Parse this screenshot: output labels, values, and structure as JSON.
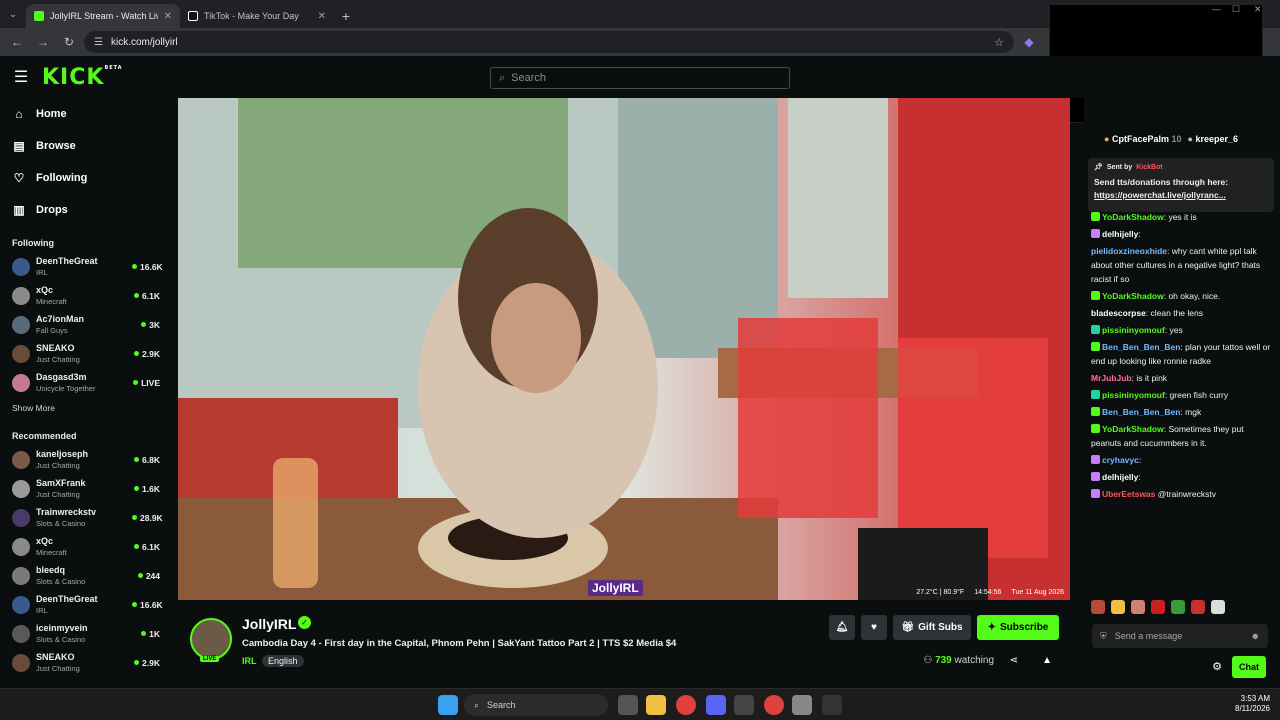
{
  "browser": {
    "tabs": [
      {
        "title": "JollyIRL Stream - Watch Live",
        "active": true,
        "favicon_color": "#53fc18"
      },
      {
        "title": "TikTok - Make Your Day",
        "active": false,
        "favicon_color": "#ffffff"
      }
    ],
    "url": "kick.com/jollyirl"
  },
  "header": {
    "logo": "KICK",
    "logo_badge": "BETA",
    "search_placeholder": "Search"
  },
  "sidebar": {
    "nav": [
      {
        "label": "Home",
        "icon": "home-icon"
      },
      {
        "label": "Browse",
        "icon": "browse-icon"
      },
      {
        "label": "Following",
        "icon": "heart-icon"
      },
      {
        "label": "Drops",
        "icon": "drops-icon"
      }
    ],
    "following_title": "Following",
    "following": [
      {
        "name": "DeenTheGreat",
        "category": "IRL",
        "viewers": "16.6K",
        "color": "#3a5a8c"
      },
      {
        "name": "xQc",
        "category": "Minecraft",
        "viewers": "6.1K",
        "color": "#8a8a8a"
      },
      {
        "name": "Ac7ionMan",
        "category": "Fall Guys",
        "viewers": "3K",
        "color": "#5a6a7a"
      },
      {
        "name": "SNEAKO",
        "category": "Just Chatting",
        "viewers": "2.9K",
        "color": "#6a4a3a"
      },
      {
        "name": "Dasgasd3m",
        "category": "Unicycle Together",
        "viewers": "LIVE",
        "color": "#c87890"
      }
    ],
    "show_more": "Show More",
    "recommended_title": "Recommended",
    "recommended": [
      {
        "name": "kaneljoseph",
        "category": "Just Chatting",
        "viewers": "6.8K",
        "color": "#7a5a4a"
      },
      {
        "name": "SamXFrank",
        "category": "Just Chatting",
        "viewers": "1.6K",
        "color": "#9a9a9a"
      },
      {
        "name": "Trainwreckstv",
        "category": "Slots & Casino",
        "viewers": "28.9K",
        "color": "#4a3a6a"
      },
      {
        "name": "xQc",
        "category": "Minecraft",
        "viewers": "6.1K",
        "color": "#8a8a8a"
      },
      {
        "name": "bleedq",
        "category": "Slots & Casino",
        "viewers": "244",
        "color": "#7a7a7a"
      },
      {
        "name": "DeenTheGreat",
        "category": "IRL",
        "viewers": "16.6K",
        "color": "#3a5a8c"
      },
      {
        "name": "iceinmyvein",
        "category": "Slots & Casino",
        "viewers": "1K",
        "color": "#5a5a5a"
      },
      {
        "name": "SNEAKO",
        "category": "Just Chatting",
        "viewers": "2.9K",
        "color": "#6a4a3a"
      }
    ]
  },
  "player": {
    "watermark": "JollyIRL",
    "overlay": {
      "temp": "27.2°C | 80.9°F",
      "time": "14:54:56",
      "date": "Tue 11 Aug 2026"
    }
  },
  "stream": {
    "name": "JollyIRL",
    "live_badge": "LIVE",
    "title": "Cambodia Day 4 - First day in the Capital, Phnom Pehn | SakYant Tattoo Part 2 | TTS $2 Media $4",
    "category": "IRL",
    "language": "English",
    "gift_label": "Gift Subs",
    "subscribe_label": "Subscribe",
    "viewers": "739",
    "viewers_suffix": "watching"
  },
  "chat": {
    "leaders": [
      {
        "name": "CptFacePalm",
        "count": "10"
      },
      {
        "name": "kreeper_6",
        "count": ""
      }
    ],
    "pinned": {
      "sent_by": "Sent by",
      "author": "KickBot",
      "text": "Send tts/donations through here:",
      "link": "https://powerchat.live/jollyranc..."
    },
    "messages": [
      {
        "user": "YoDarkShadow",
        "color": "#53fc18",
        "text": ": yes it is",
        "badge": "#53fc18"
      },
      {
        "user": "delhijelly",
        "color": "#ffffff",
        "text": ":",
        "badge": "#c87dff"
      },
      {
        "user": "pielidoxzineoxhide",
        "color": "#74b9ff",
        "text": ": why cant white ppl talk about other cultures in a negative light? thats racist if so",
        "badge": ""
      },
      {
        "user": "YoDarkShadow",
        "color": "#53fc18",
        "text": ": oh okay, nice.",
        "badge": "#53fc18"
      },
      {
        "user": "bladescorpse",
        "color": "#ffffff",
        "text": ": clean the lens",
        "badge": ""
      },
      {
        "user": "pissininyomouf",
        "color": "#53fc18",
        "text": ": yes",
        "badge": "#22d3a0"
      },
      {
        "user": "Ben_Ben_Ben_Ben",
        "color": "#74b9ff",
        "text": ": plan your tattos well or end up looking like ronnie radke",
        "badge": "#53fc18"
      },
      {
        "user": "MrJubJub",
        "color": "#ff6b9d",
        "text": ": is it pink",
        "badge": ""
      },
      {
        "user": "pissininyomouf",
        "color": "#53fc18",
        "text": ": green fish curry",
        "badge": "#22d3a0"
      },
      {
        "user": "Ben_Ben_Ben_Ben",
        "color": "#74b9ff",
        "text": ": mgk",
        "badge": "#53fc18"
      },
      {
        "user": "YoDarkShadow",
        "color": "#53fc18",
        "text": ": Sometimes they put peanuts and cucummbers in it.",
        "badge": "#53fc18"
      },
      {
        "user": "cryhavyc",
        "color": "#74b9ff",
        "text": ":",
        "badge": "#c87dff"
      },
      {
        "user": "delhijelly",
        "color": "#ffffff",
        "text": ":",
        "badge": "#c87dff"
      },
      {
        "user": "UberEetswas",
        "color": "#ff5555",
        "text": " @trainwreckstv",
        "badge": "#c87dff"
      }
    ],
    "input_placeholder": "Send a message",
    "chat_button": "Chat"
  },
  "taskbar": {
    "search": "Search",
    "time": "3:53 AM",
    "date": "8/11/2026"
  }
}
